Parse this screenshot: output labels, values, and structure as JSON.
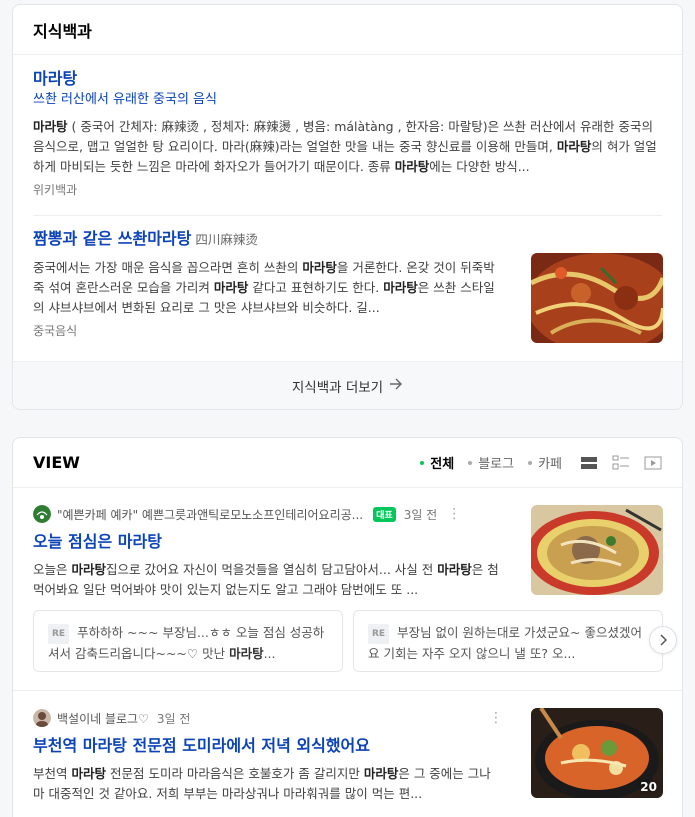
{
  "knowledge": {
    "header_title": "지식백과",
    "entry1": {
      "title": "마라탕",
      "subtitle": "쓰촨 러산에서 유래한 중국의 음식",
      "desc_parts": [
        "마라탕",
        " ( 중국어 간체자: 麻辣烫 , 정체자: 麻辣燙 , 병음: málàtàng , 한자음: 마랄탕)은 쓰촨 러산에서 유래한 중국의 음식으로, 맵고 얼얼한 탕 요리이다. 마라(麻辣)라는 얼얼한 맛을 내는 중국 향신료를 이용해 만들며, ",
        "마라탕",
        "의 혀가 얼얼하게 마비되는 듯한 느낌은 마라에 화자오가 들어가기 때문이다. 종류 ",
        "마라탕",
        "에는 다양한 방식..."
      ],
      "source": "위키백과"
    },
    "entry2": {
      "title_prefix": "짬뽕과 같은 쓰촨",
      "title_highlight": "마라탕",
      "hanja": "四川麻辣烫",
      "desc_parts": [
        "중국에서는 가장 매운 음식을 꼽으라면 흔히 쓰촨의 ",
        "마라탕",
        "을 거론한다. 온갖 것이 뒤죽박죽 섞여 혼란스러운 모습을 가리켜 ",
        "마라탕",
        " 같다고 표현하기도 한다. ",
        "마라탕",
        "은 쓰촨 스타일의 샤브샤브에서 변화된 요리로 그 맛은 샤브샤브와 비슷하다. 길..."
      ],
      "source": "중국음식"
    },
    "more_label": "지식백과 더보기"
  },
  "view": {
    "header_title": "VIEW",
    "filters": [
      "전체",
      "블로그",
      "카페"
    ],
    "post1": {
      "author": "\"예쁜카페 예카\" 예쁜그릇과앤틱로모노소프인테리어요리공...",
      "badge": "대표",
      "time": "3일 전",
      "title_prefix": "오늘 점심은 ",
      "title_highlight": "마라탕",
      "desc_parts": [
        "오늘은 ",
        "마라탕",
        "집으로 갔어요 자신이 먹을것들을 열심히 담고담아서... 사실 전 ",
        "마라탕",
        "은 첨 먹어봐요 일단 먹어봐야 맛이 있는지 없는지도 알고 그래야 담번에도 또 ..."
      ]
    },
    "replies": [
      {
        "tag": "RE",
        "text_a": "푸하하하 ~~~ 부장님...ㅎㅎ 오늘 점심 성공하셔서 감축드리옵니다~~~♡ 맛난 ",
        "text_b": "마라탕",
        "text_c": "..."
      },
      {
        "tag": "RE",
        "text_a": "부장님 없이 원하는대로 가셨군요~ 좋으셨겠어요 기회는 자주 오지 않으니 낼 또? 오...",
        "text_b": "",
        "text_c": ""
      }
    ],
    "post2": {
      "author": "백설이네 블로그♡",
      "time": "3일 전",
      "title_prefix": "부천역 ",
      "title_highlight": "마라탕",
      "title_suffix": " 전문점 도미라에서 저녁 외식했어요",
      "desc_parts": [
        "부천역 ",
        "마라탕",
        " 전문점 도미라 마라음식은 호불호가 좀 갈리지만 ",
        "마라탕",
        "은 그 중에는 그나마 대중적인 것 같아요. 저희 부부는 마라상궈나 마라훠궈를 많이 먹는 편..."
      ],
      "image_count": "20"
    }
  },
  "colors": {
    "link": "#0c43b7",
    "accent": "#03c75a"
  }
}
